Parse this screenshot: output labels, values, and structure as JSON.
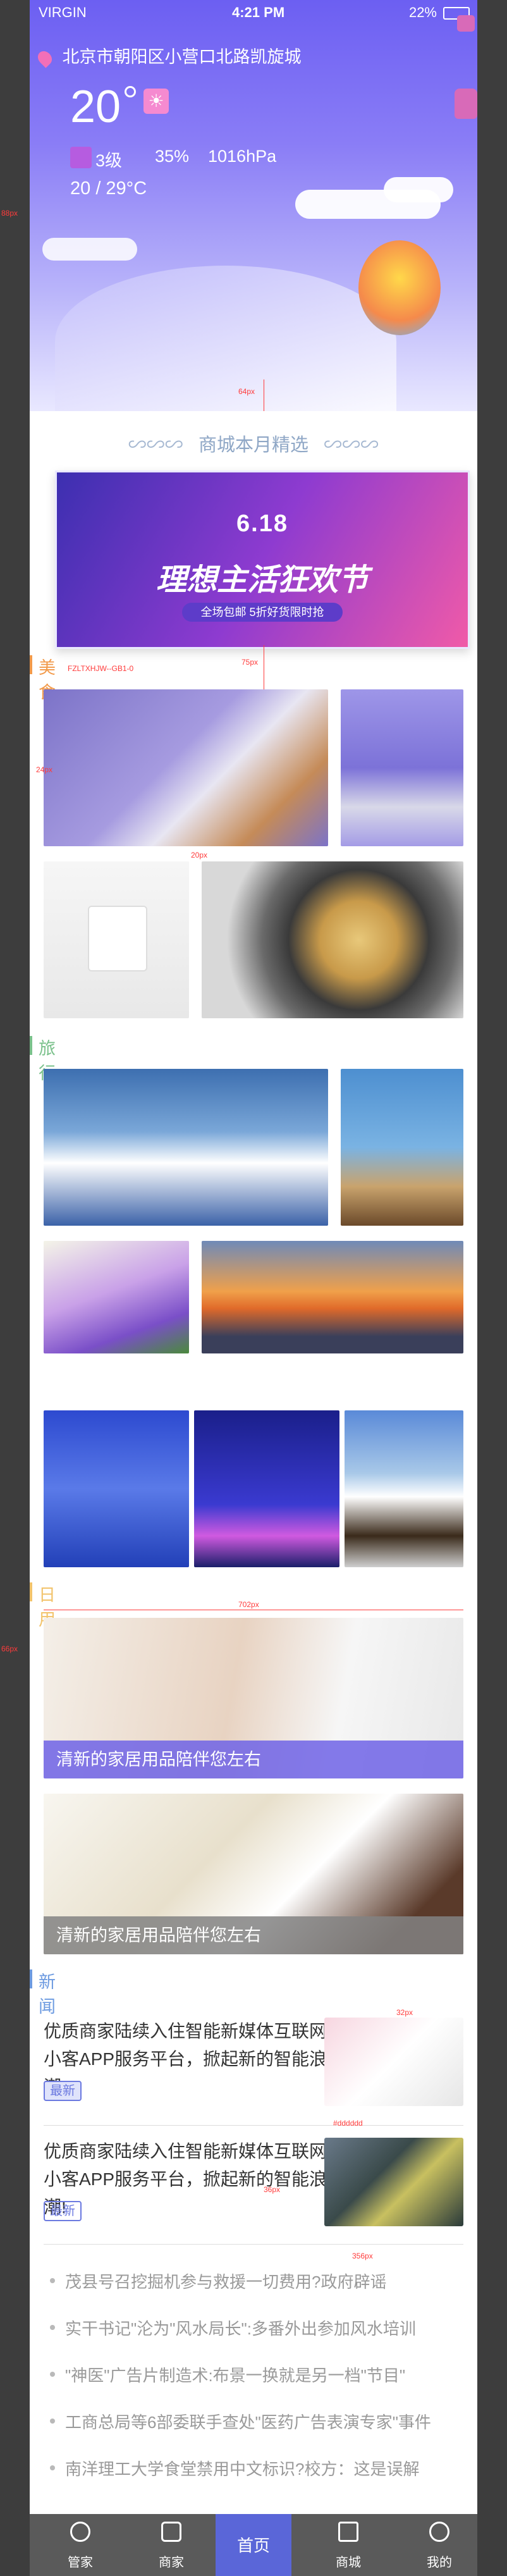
{
  "status_bar": {
    "carrier": "VIRGIN",
    "time": "4:21 PM",
    "battery": "22%"
  },
  "weather": {
    "location": "北京市朝阳区小营口北路凯旋城",
    "temperature": "20",
    "air_quality": "3级",
    "humidity": "35%",
    "pressure": "1016hPa",
    "range": "20 / 29°C"
  },
  "sections": {
    "featured_title": "商城本月精选",
    "food": "美食",
    "travel": "旅行",
    "daily": "日用",
    "news": "新闻"
  },
  "banner": {
    "line1": "6.18",
    "line2": "理想主活狂欢节",
    "line3": "全场包邮 5折好货限时抢"
  },
  "daily_captions": [
    "清新的家居用品陪伴您左右",
    "清新的家居用品陪伴您左右"
  ],
  "news_items": [
    {
      "text": "优质商家陆续入住智能新媒体互联网小客APP服务平台，掀起新的智能浪潮!",
      "tag": "最新"
    },
    {
      "text": "优质商家陆续入住智能新媒体互联网小客APP服务平台，掀起新的智能浪潮!",
      "tag": "最新"
    }
  ],
  "bullets": [
    "茂县号召挖掘机参与救援一切费用?政府辟谣",
    "实干书记\"沦为\"风水局长\":多番外出参加风水培训",
    "\"神医\"广告片制造术:布景一换就是另一档\"节目\"",
    "工商总局等6部委联手查处\"医药广告表演专家\"事件",
    "南洋理工大学食堂禁用中文标识?校方：这是误解"
  ],
  "tabs": [
    {
      "label": "管家",
      "icon": "butler-icon"
    },
    {
      "label": "商家",
      "icon": "merchant-icon"
    },
    {
      "label": "首页",
      "icon": "home-icon"
    },
    {
      "label": "商城",
      "icon": "mall-icon"
    },
    {
      "label": "我的",
      "icon": "profile-icon"
    }
  ],
  "annotations": {
    "px_88": "88px",
    "px_66": "66px",
    "px_64": "64px",
    "px_40": "40px",
    "px_75": "75px",
    "px_20": "20px",
    "px_24": "24px",
    "px_702": "702px",
    "px_356": "356px",
    "px_32": "32px",
    "px_36": "36px",
    "color_ffffff": "#ffffff",
    "color_478898": "#478898",
    "color_4fd6a5": "#4fd6a5",
    "color_ddd": "#dddddd",
    "color_222": "#222222",
    "font_note": "FZLTXHJW--GB1-0"
  },
  "colors": {
    "hero_top": "#6c5ff2",
    "accent_orange": "#f29a4a",
    "accent_blue": "#6c7ae0",
    "tabbar": "#5a5a5a",
    "tab_active": "#5a66d8"
  }
}
